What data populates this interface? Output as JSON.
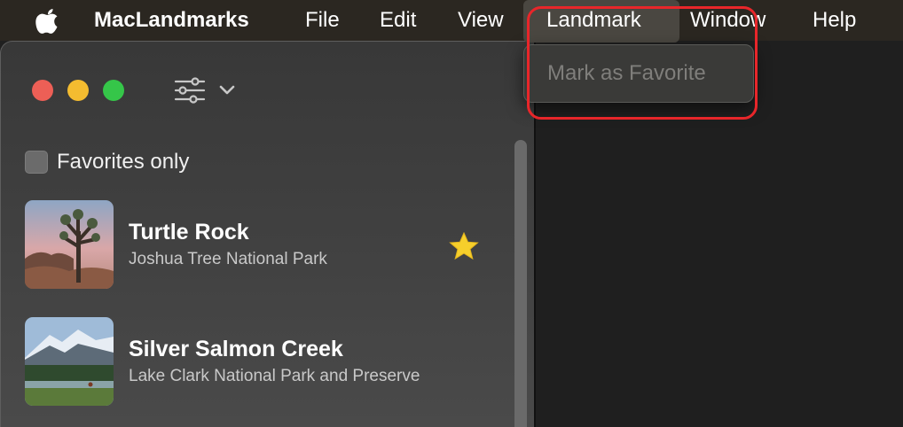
{
  "menubar": {
    "app_name": "MacLandmarks",
    "items": [
      "File",
      "Edit",
      "View",
      "Landmark",
      "Window",
      "Help"
    ],
    "active_menu": "Landmark"
  },
  "dropdown": {
    "items": [
      {
        "label": "Mark as Favorite",
        "enabled": false
      }
    ]
  },
  "sidebar": {
    "favorites_toggle": {
      "label": "Favorites only",
      "checked": false
    },
    "filter_icon": "slider-filter-icon",
    "landmarks": [
      {
        "name": "Turtle Rock",
        "park": "Joshua Tree National Park",
        "favorite": true
      },
      {
        "name": "Silver Salmon Creek",
        "park": "Lake Clark National Park and Preserve",
        "favorite": false
      }
    ]
  },
  "colors": {
    "menubar_bg": "#2b2721",
    "highlight": "#e8262a",
    "star": "#f6cf2b",
    "traffic_close": "#ed5f56",
    "traffic_minimize": "#f4bc30",
    "traffic_zoom": "#35c649"
  }
}
